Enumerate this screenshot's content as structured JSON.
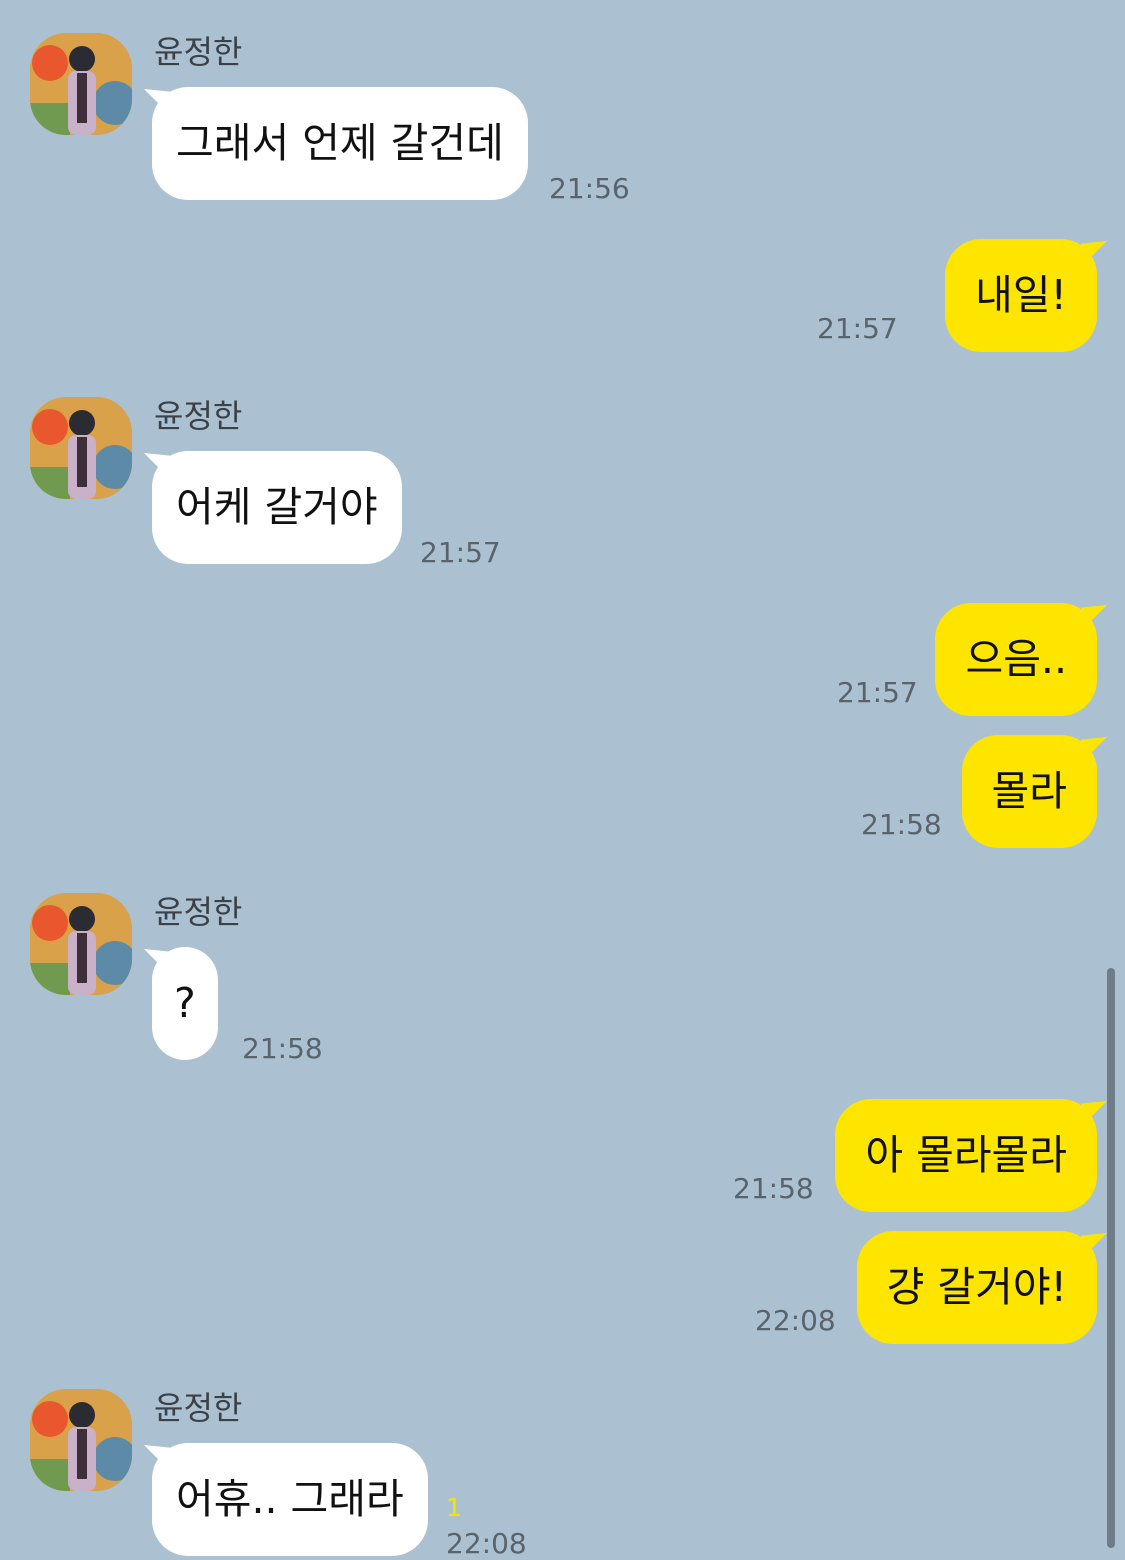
{
  "chat": {
    "sender_name": "윤정한",
    "messages": [
      {
        "from": "other",
        "text": "그래서 언제 갈건데",
        "time": "21:56"
      },
      {
        "from": "me",
        "text": "내일!",
        "time": "21:57"
      },
      {
        "from": "other",
        "text": "어케 갈거야",
        "time": "21:57"
      },
      {
        "from": "me",
        "text": "으음..",
        "time": "21:57"
      },
      {
        "from": "me",
        "text": "몰라",
        "time": "21:58"
      },
      {
        "from": "other",
        "text": "?",
        "time": "21:58"
      },
      {
        "from": "me",
        "text": "아 몰라몰라",
        "time": "21:58"
      },
      {
        "from": "me",
        "text": "걍 갈거야!",
        "time": "22:08"
      },
      {
        "from": "other",
        "text": "어휴.. 그래라",
        "time": "22:08",
        "unread_count": "1"
      }
    ]
  },
  "colors": {
    "background": "#abc1d1",
    "incoming_bubble": "#ffffff",
    "outgoing_bubble": "#fee500",
    "unread": "#f7e500",
    "time_text": "#59636d"
  }
}
